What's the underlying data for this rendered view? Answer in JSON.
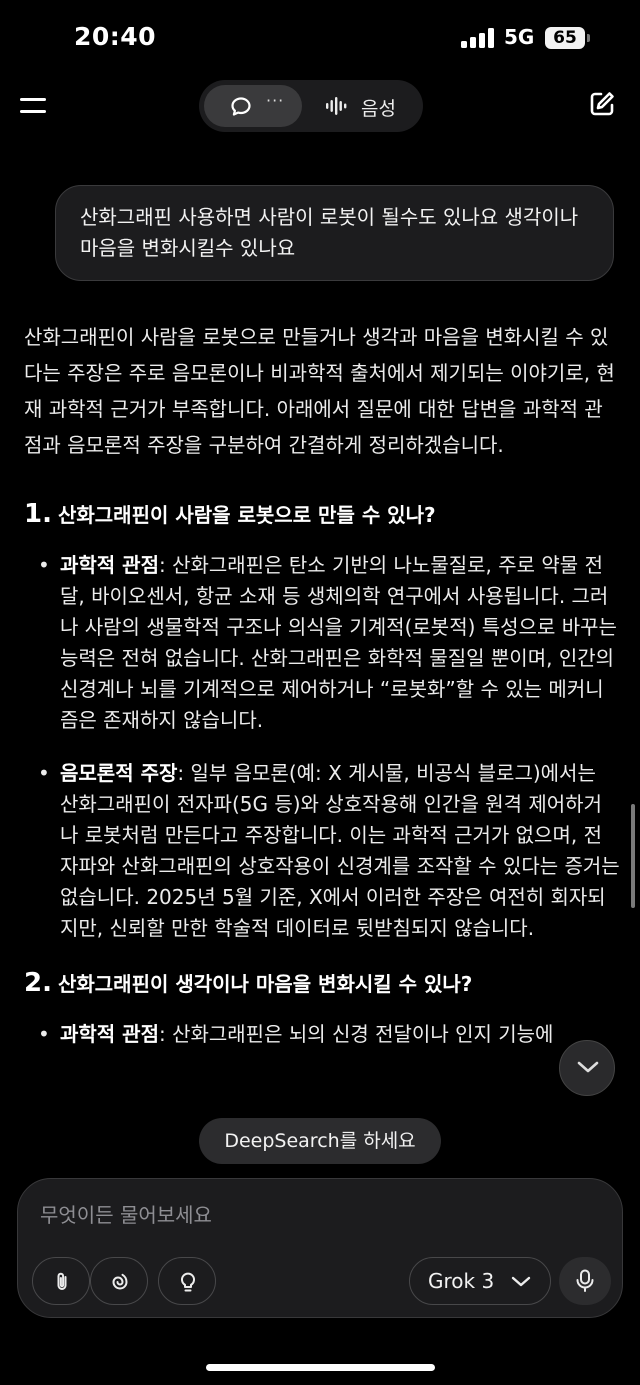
{
  "status_bar": {
    "time": "20:40",
    "network": "5G",
    "battery": "65"
  },
  "header": {
    "chat_mode_dots": "···",
    "voice_label": "음성"
  },
  "user_message": "산화그래핀 사용하면 사람이 로봇이 될수도 있나요 생각이나 마음을 변화시킬수 있나요",
  "answer": {
    "intro": "산화그래핀이 사람을 로봇으로 만들거나 생각과 마음을 변화시킬 수 있다는 주장은 주로 음모론이나 비과학적 출처에서 제기되는 이야기로, 현재 과학적 근거가 부족합니다. 아래에서 질문에 대한 답변을 과학적 관점과 음모론적 주장을 구분하여 간결하게 정리하겠습니다.",
    "sections": [
      {
        "number": "1.",
        "title": "산화그래핀이 사람을 로봇으로 만들 수 있나?",
        "bullets": [
          {
            "label": "과학적 관점",
            "text": ": 산화그래핀은 탄소 기반의 나노물질로, 주로 약물 전달, 바이오센서, 항균 소재 등 생체의학 연구에서 사용됩니다. 그러나 사람의 생물학적 구조나 의식을 기계적(로봇적) 특성으로 바꾸는 능력은 전혀 없습니다. 산화그래핀은 화학적 물질일 뿐이며, 인간의 신경계나 뇌를 기계적으로 제어하거나 “로봇화”할 수 있는 메커니즘은 존재하지 않습니다."
          },
          {
            "label": "음모론적 주장",
            "text": ": 일부 음모론(예: X 게시물, 비공식 블로그)에서는 산화그래핀이 전자파(5G 등)와 상호작용해 인간을 원격 제어하거나 로봇처럼 만든다고 주장합니다. 이는 과학적 근거가 없으며, 전자파와 산화그래핀의 상호작용이 신경계를 조작할 수 있다는 증거는 없습니다. 2025년 5월 기준, X에서 이러한 주장은 여전히 회자되지만, 신뢰할 만한 학술적 데이터로 뒷받침되지 않습니다."
          }
        ]
      },
      {
        "number": "2.",
        "title": "산화그래핀이 생각이나 마음을 변화시킬 수 있나?",
        "bullets": [
          {
            "label": "과학적 관점",
            "text": ": 산화그래핀은 뇌의 신경 전달이나 인지 기능에"
          }
        ]
      }
    ]
  },
  "toast": "DeepSearch를 하세요",
  "composer": {
    "placeholder": "무엇이든 물어보세요",
    "model": "Grok 3"
  },
  "icons": {
    "menu": "menu-icon",
    "chat": "chat-bubble-icon",
    "voice": "waveform-icon",
    "new_chat": "edit-icon",
    "attach": "paperclip-icon",
    "think": "spiral-icon",
    "ideas": "lightbulb-icon",
    "model_dropdown": "chevron-down-icon",
    "mic": "microphone-icon",
    "scroll_down": "chevron-down-icon"
  }
}
